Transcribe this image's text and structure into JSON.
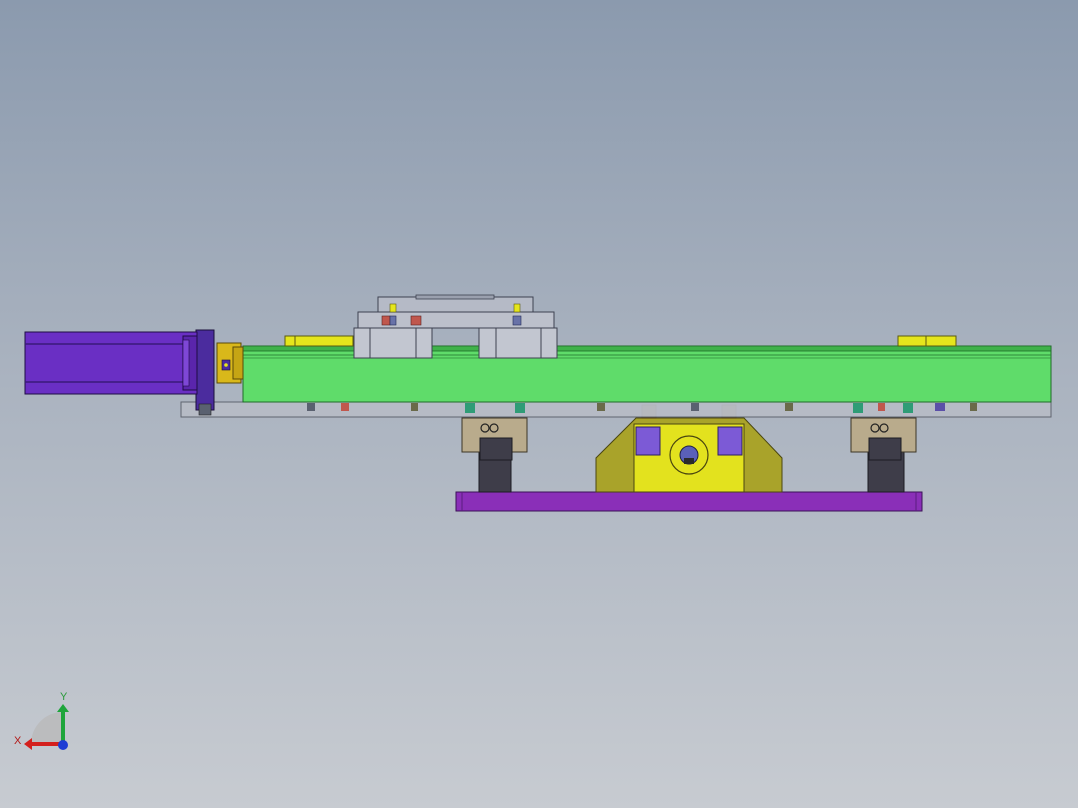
{
  "viewport": {
    "background_top": "#8b9aae",
    "background_bottom": "#c7cbd1"
  },
  "model": {
    "parts": [
      "servo-motor",
      "motor-flange",
      "shaft-coupling",
      "linear-module-body",
      "module-base-plate",
      "carriage-slider",
      "limit-sensor-bracket",
      "linear-guide-block",
      "pivot-support-block",
      "bottom-mounting-plate"
    ],
    "colors": {
      "motor": "#6a2fc4",
      "motor_flange": "#4b2c9e",
      "coupling": "#d9b81a",
      "module_body": "#5fdc6a",
      "module_rail": "#3fb24a",
      "base_plate": "#b7bcc6",
      "carriage": "#b5bac6",
      "sensor": "#e5e61c",
      "guide_block": "#b9ab8c",
      "guide_rail": "#3e3d49",
      "support_side": "#a9a32a",
      "support_center": "#e3e21e",
      "bottom_plate": "#8a2fb8",
      "bolt_green": "#2f9c76",
      "bolt_red": "#c0574d"
    }
  },
  "triad": {
    "x_label": "X",
    "y_label": "Y",
    "x_color": "#d4201d",
    "y_color": "#1ea53b",
    "z_color": "#1d3cd4"
  }
}
